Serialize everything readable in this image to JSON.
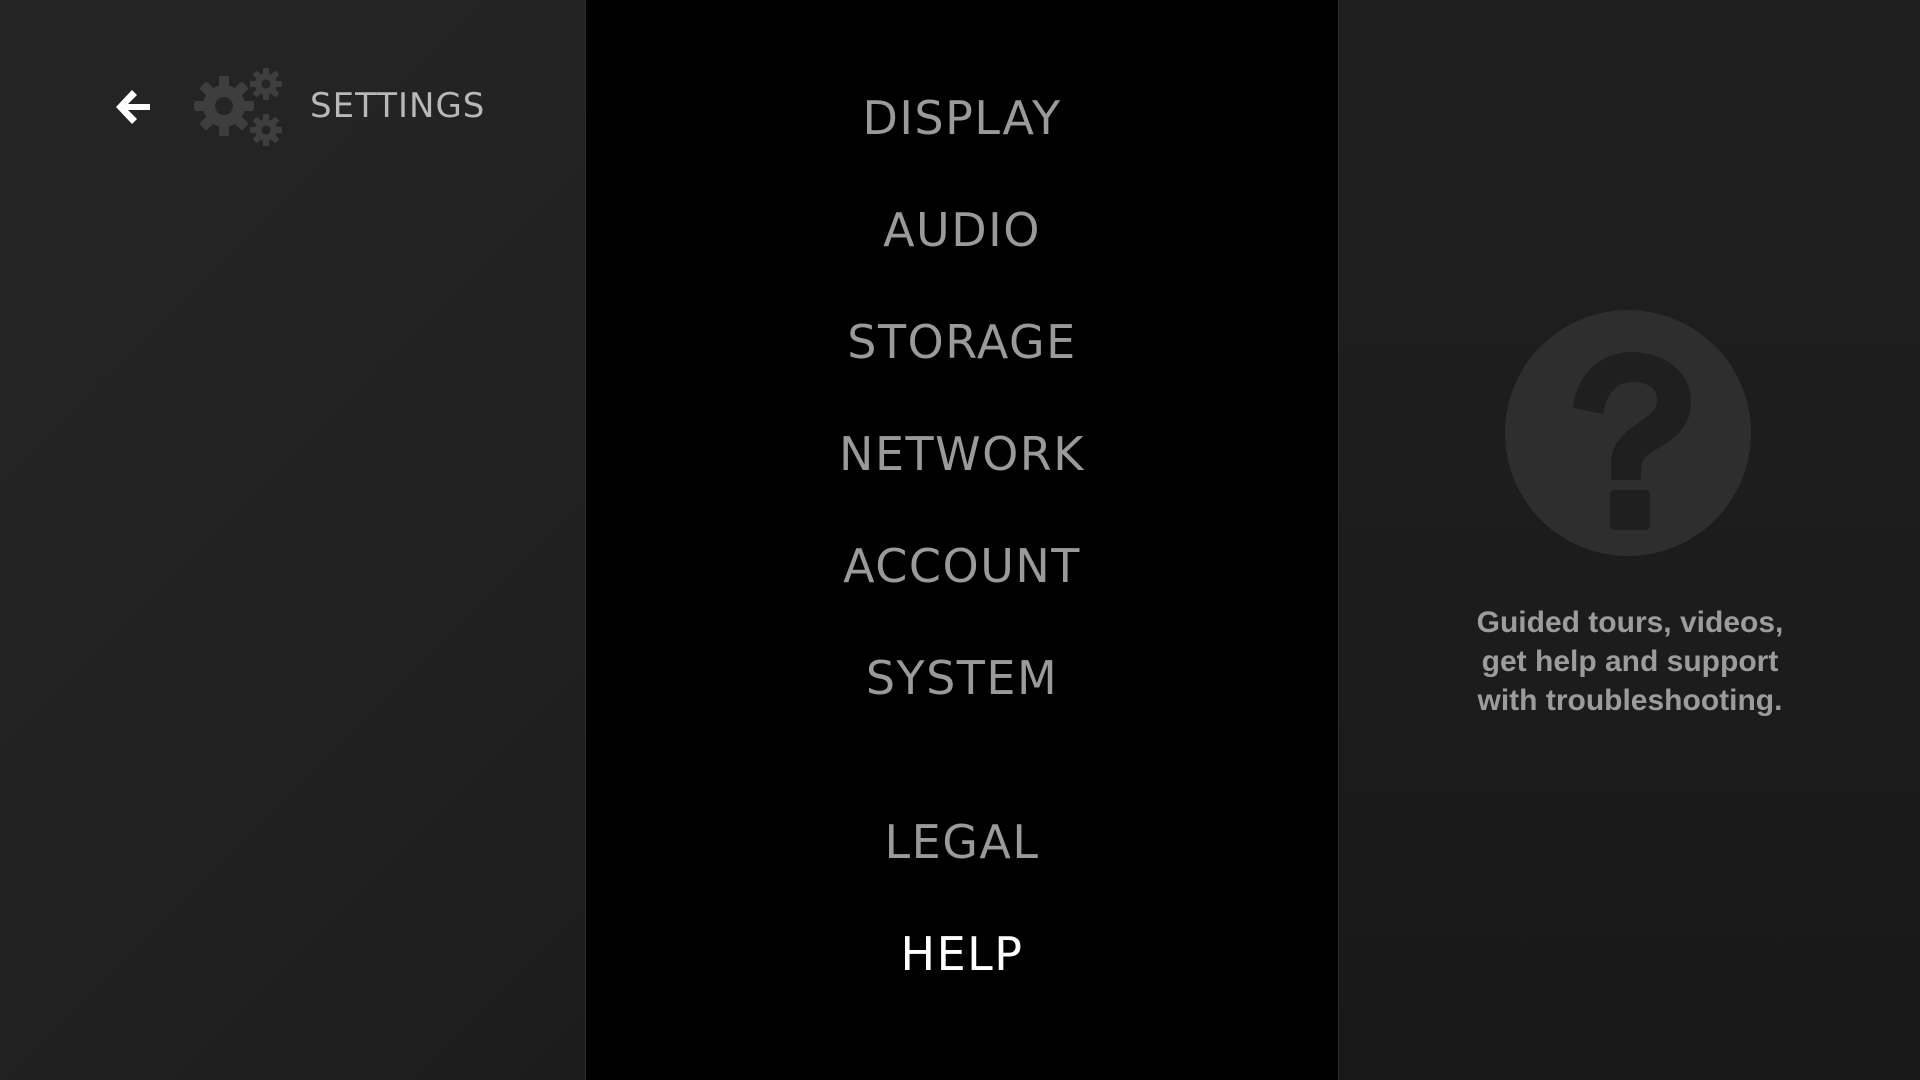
{
  "header": {
    "title": "SETTINGS",
    "back_icon": "back-arrow-icon",
    "settings_icon": "gears-icon"
  },
  "menu": {
    "items": [
      {
        "label": "DISPLAY",
        "selected": false
      },
      {
        "label": "AUDIO",
        "selected": false
      },
      {
        "label": "STORAGE",
        "selected": false
      },
      {
        "label": "NETWORK",
        "selected": false
      },
      {
        "label": "ACCOUNT",
        "selected": false
      },
      {
        "label": "SYSTEM",
        "selected": false
      },
      {
        "label": "LEGAL",
        "selected": false
      },
      {
        "label": "HELP",
        "selected": true
      }
    ]
  },
  "detail": {
    "icon": "question-mark-icon",
    "description_lines": [
      "Guided tours, videos,",
      "get help and support",
      "with troubleshooting."
    ]
  },
  "colors": {
    "selected_text": "#ffffff",
    "unselected_text": "#9a9a9a",
    "icon_circle": "#2e2e2e",
    "icon_glyph": "#1f1f1f"
  }
}
